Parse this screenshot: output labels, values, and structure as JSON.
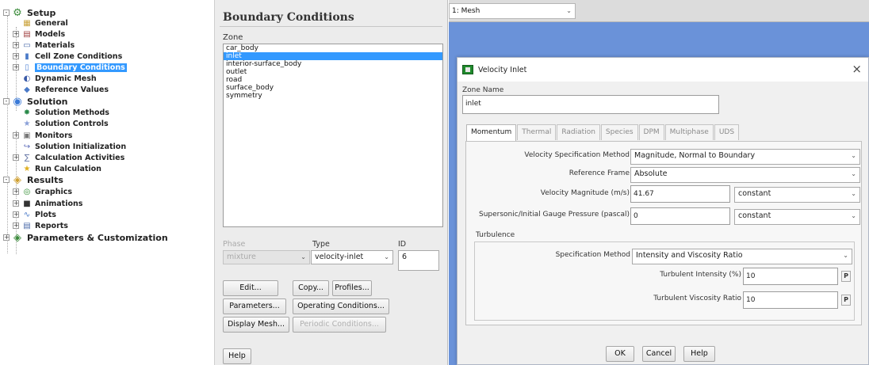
{
  "tree": {
    "items": [
      {
        "label": "Setup",
        "icon": "setup-icon",
        "top": true
      },
      {
        "label": "General",
        "icon": "general-icon"
      },
      {
        "label": "Models",
        "icon": "models-icon"
      },
      {
        "label": "Materials",
        "icon": "materials-icon"
      },
      {
        "label": "Cell Zone Conditions",
        "icon": "cell-zone-icon"
      },
      {
        "label": "Boundary Conditions",
        "icon": "boundary-icon"
      },
      {
        "label": "Dynamic Mesh",
        "icon": "dynamic-mesh-icon"
      },
      {
        "label": "Reference Values",
        "icon": "reference-values-icon"
      },
      {
        "label": "Solution",
        "icon": "solution-icon",
        "top": true
      },
      {
        "label": "Solution Methods",
        "icon": "solution-methods-icon"
      },
      {
        "label": "Solution Controls",
        "icon": "solution-controls-icon"
      },
      {
        "label": "Monitors",
        "icon": "monitors-icon"
      },
      {
        "label": "Solution Initialization",
        "icon": "solution-init-icon"
      },
      {
        "label": "Calculation Activities",
        "icon": "calc-activities-icon"
      },
      {
        "label": "Run Calculation",
        "icon": "run-calc-icon"
      },
      {
        "label": "Results",
        "icon": "results-icon",
        "top": true
      },
      {
        "label": "Graphics",
        "icon": "graphics-icon"
      },
      {
        "label": "Animations",
        "icon": "animations-icon"
      },
      {
        "label": "Plots",
        "icon": "plots-icon"
      },
      {
        "label": "Reports",
        "icon": "reports-icon"
      },
      {
        "label": "Parameters & Customization",
        "icon": "parameters-icon",
        "top": true
      }
    ]
  },
  "bc": {
    "title": "Boundary Conditions",
    "zone_label": "Zone",
    "zones": [
      "car_body",
      "inlet",
      "interior-surface_body",
      "outlet",
      "road",
      "surface_body",
      "symmetry"
    ],
    "selected_zone": "inlet",
    "phase_label": "Phase",
    "phase_value": "mixture",
    "type_label": "Type",
    "type_value": "velocity-inlet",
    "id_label": "ID",
    "id_value": "6",
    "buttons": {
      "edit": "Edit...",
      "copy": "Copy...",
      "profiles": "Profiles...",
      "parameters": "Parameters...",
      "operating": "Operating Conditions...",
      "display_mesh": "Display Mesh...",
      "periodic": "Periodic Conditions...",
      "help": "Help"
    }
  },
  "mesh": {
    "selector": "1: Mesh",
    "bg_color": "#6a92d9"
  },
  "dialog": {
    "title": "Velocity Inlet",
    "zone_name_label": "Zone Name",
    "zone_name_value": "inlet",
    "tabs": [
      "Momentum",
      "Thermal",
      "Radiation",
      "Species",
      "DPM",
      "Multiphase",
      "UDS"
    ],
    "active_tab": "Momentum",
    "velocity_spec_label": "Velocity Specification Method",
    "velocity_spec_value": "Magnitude, Normal to Boundary",
    "ref_frame_label": "Reference Frame",
    "ref_frame_value": "Absolute",
    "vel_mag_label": "Velocity Magnitude (m/s)",
    "vel_mag_value": "41.67",
    "vel_mag_mode": "constant",
    "gauge_label": "Supersonic/Initial Gauge Pressure (pascal)",
    "gauge_value": "0",
    "gauge_mode": "constant",
    "turbulence_label": "Turbulence",
    "spec_method_label": "Specification Method",
    "spec_method_value": "Intensity and Viscosity Ratio",
    "ti_label": "Turbulent Intensity (%)",
    "ti_value": "10",
    "tvr_label": "Turbulent Viscosity Ratio",
    "tvr_value": "10",
    "p_button": "P",
    "ok": "OK",
    "cancel": "Cancel",
    "help": "Help"
  }
}
